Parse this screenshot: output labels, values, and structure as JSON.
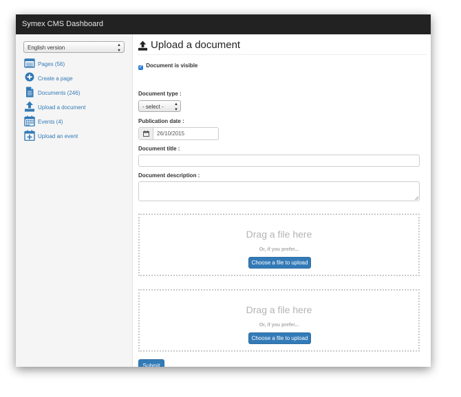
{
  "navbar": {
    "brand": "Symex CMS Dashboard"
  },
  "sidebar": {
    "language_select": {
      "value": "English version"
    },
    "items": [
      {
        "label": "Pages (56)",
        "icon": "list-icon"
      },
      {
        "label": "Create a page",
        "icon": "plus-circle-icon"
      },
      {
        "label": "Documents (246)",
        "icon": "document-icon"
      },
      {
        "label": "Upload a document",
        "icon": "upload-icon"
      },
      {
        "label": "Events (4)",
        "icon": "calendar-icon"
      },
      {
        "label": "Upload an event",
        "icon": "calendar-plus-icon"
      }
    ]
  },
  "main": {
    "title": "Upload a document",
    "visible_checkbox": {
      "label": "Document is visible",
      "checked": true
    },
    "document_type": {
      "label": "Document type :",
      "value": "- select -"
    },
    "publication_date": {
      "label": "Publication date :",
      "value": "26/10/2015"
    },
    "document_title": {
      "label": "Document title :",
      "value": ""
    },
    "document_description": {
      "label": "Document description :",
      "value": ""
    },
    "dropzones": [
      {
        "title": "Drag a file here",
        "subtitle": "Or, if you prefer...",
        "button": "Choose a file to upload"
      },
      {
        "title": "Drag a file here",
        "subtitle": "Or, if you prefer...",
        "button": "Choose a file to upload"
      }
    ],
    "submit_label": "Submit"
  },
  "colors": {
    "navbar_bg": "#222222",
    "link": "#337ab7",
    "primary_button": "#337ab7",
    "sidebar_bg": "#f5f5f5"
  }
}
